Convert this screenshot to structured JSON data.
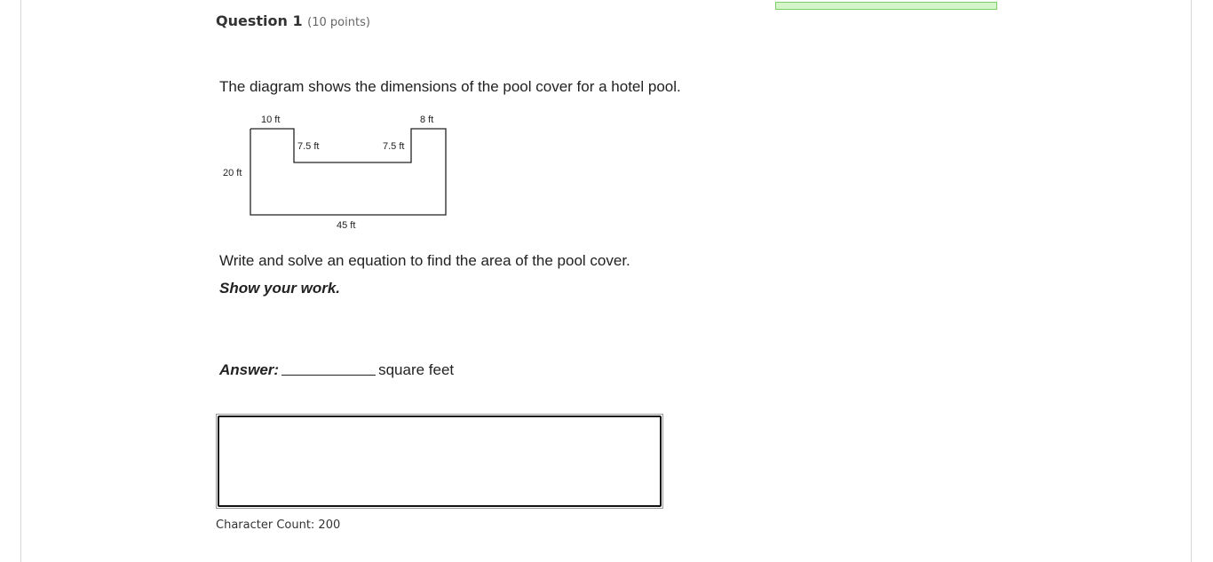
{
  "question": {
    "title": "Question 1",
    "points": "(10 points)"
  },
  "prompt": "The diagram shows the dimensions of the pool cover for a hotel pool.",
  "diagram": {
    "labels": {
      "top_left": "10 ft",
      "top_right": "8 ft",
      "inner_left": "7.5 ft",
      "inner_right": "7.5 ft",
      "left_side": "20 ft",
      "bottom": "45 ft"
    }
  },
  "instruction": "Write and solve an equation to find the area of the pool cover.",
  "show_work": "Show your work.",
  "answer": {
    "label": "Answer:",
    "unit": "square feet"
  },
  "response": {
    "value": ""
  },
  "character_count": "Character Count: 200",
  "colors": {
    "progress_fill": "#d4f5c8",
    "progress_border": "#7ccf68"
  }
}
